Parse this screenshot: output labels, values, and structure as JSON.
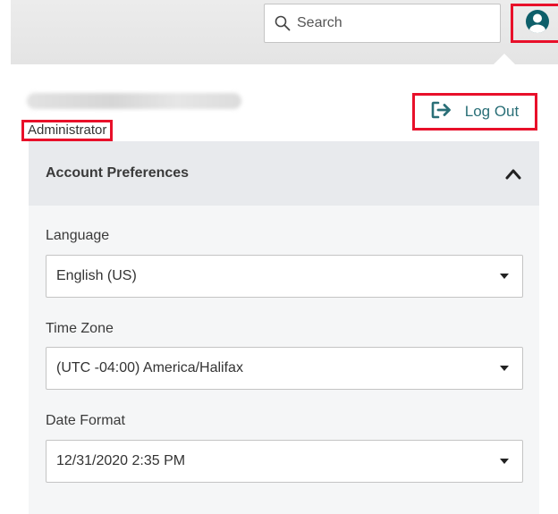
{
  "header": {
    "search": {
      "placeholder": "Search",
      "icon": "search-icon"
    },
    "avatar": {
      "icon": "user-circle-icon",
      "color": "#0e5f6a"
    }
  },
  "account": {
    "role": "Administrator",
    "logout_label": "Log Out",
    "logout_icon": "sign-out-icon",
    "accent_color": "#2a6f77"
  },
  "preferences": {
    "title": "Account Preferences",
    "expanded": true,
    "fields": [
      {
        "label": "Language",
        "value": "English (US)"
      },
      {
        "label": "Time Zone",
        "value": "(UTC -04:00) America/Halifax"
      },
      {
        "label": "Date Format",
        "value": "12/31/2020 2:35 PM"
      }
    ]
  },
  "highlight_color": "#e8102a"
}
